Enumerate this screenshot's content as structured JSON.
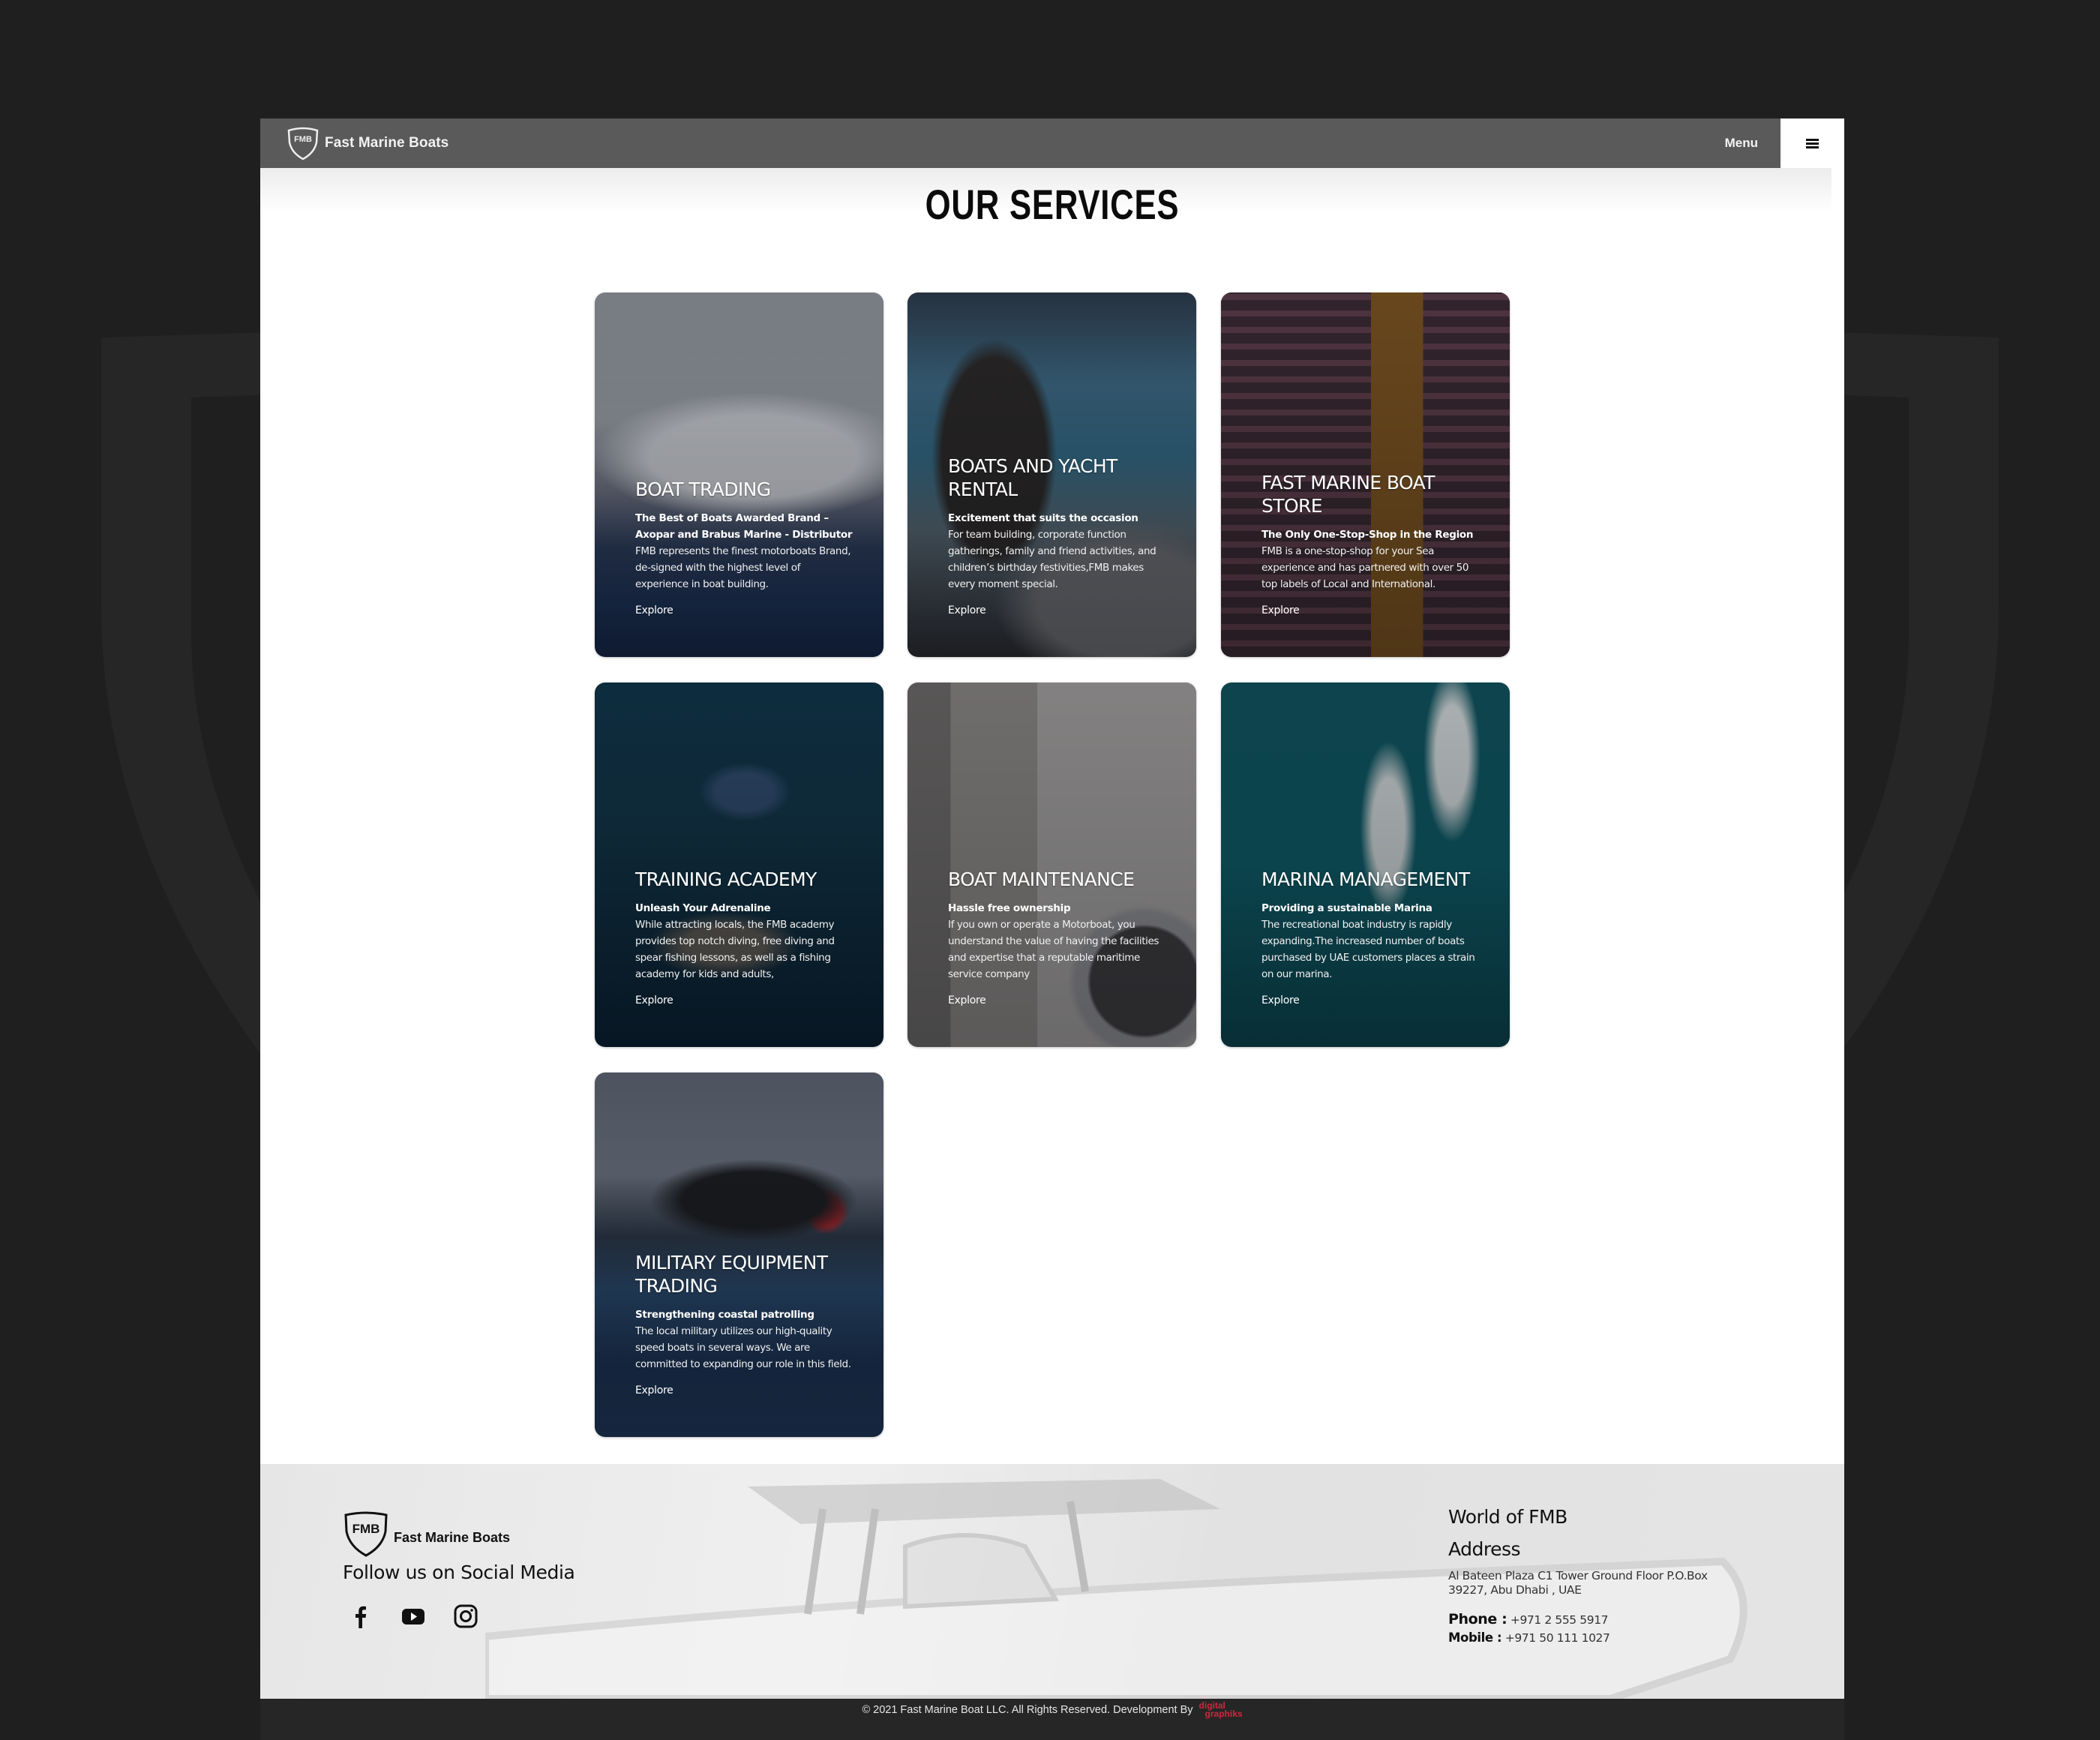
{
  "header": {
    "brand": "Fast Marine Boats",
    "logo_text": "FMB",
    "menu_label": "Menu"
  },
  "page_title": "OUR SERVICES",
  "services": [
    {
      "title": "BOAT TRADING",
      "subtitle": "The Best of Boats Awarded Brand – Axopar and Brabus Marine - Distributor",
      "description": "FMB represents the finest motorboats Brand, de-signed with the highest level of experience in boat building.",
      "link": "Explore"
    },
    {
      "title": "BOATS AND YACHT RENTAL",
      "subtitle": "Excitement that suits the occasion",
      "description": "For team building, corporate function gatherings, family and friend activities, and children’s birthday festivities,FMB makes every moment special.",
      "link": "Explore"
    },
    {
      "title": "FAST MARINE BOAT STORE",
      "subtitle": "The Only One-Stop-Shop in the Region",
      "description": "FMB is a one-stop-shop for your Sea experience and has partnered with over 50 top labels of Local and International.",
      "link": "Explore"
    },
    {
      "title": "TRAINING ACADEMY",
      "subtitle": "Unleash Your Adrenaline",
      "description": "While attracting locals, the FMB academy provides top notch diving, free diving and spear fishing lessons, as well as a fishing academy for kids and adults,",
      "link": "Explore"
    },
    {
      "title": "BOAT MAINTENANCE",
      "subtitle": "Hassle free ownership",
      "description": "If you own or operate a Motorboat, you understand the value of having the facilities and expertise that a reputable maritime service company",
      "link": "Explore"
    },
    {
      "title": "MARINA MANAGEMENT",
      "subtitle": "Providing a sustainable Marina",
      "description": "The recreational boat industry is rapidly expanding.The increased number of boats purchased by UAE customers places a strain on our marina.",
      "link": "Explore"
    },
    {
      "title": "MILITARY EQUIPMENT TRADING",
      "subtitle": "Strengthening coastal patrolling",
      "description": "The local military utilizes our high-quality speed boats in several ways. We are committed to expanding our role in this field.",
      "link": "Explore"
    }
  ],
  "footer": {
    "brand": "Fast Marine Boats",
    "logo_text": "FMB",
    "follow_heading": "Follow us on Social Media",
    "socials": [
      "facebook-icon",
      "youtube-icon",
      "instagram-icon"
    ],
    "world_heading": "World of FMB",
    "address_heading": "Address",
    "address": "Al Bateen Plaza C1 Tower Ground Floor P.O.Box 39227, Abu Dhabi , UAE",
    "phone_label": "Phone :",
    "phone": "+971 2 555 5917",
    "mobile_label": "Mobile :",
    "mobile": "+971 50 111 1027",
    "copyright": "© 2021 Fast Marine Boat LLC. All Rights Reserved. Development By",
    "developer_line1": "digital",
    "developer_line2": "graphiks",
    "developer_color": "#d0263d"
  },
  "colors": {
    "background": "#1f1f1f",
    "header": "#5a5a5a",
    "bottom_bar": "#262626"
  }
}
